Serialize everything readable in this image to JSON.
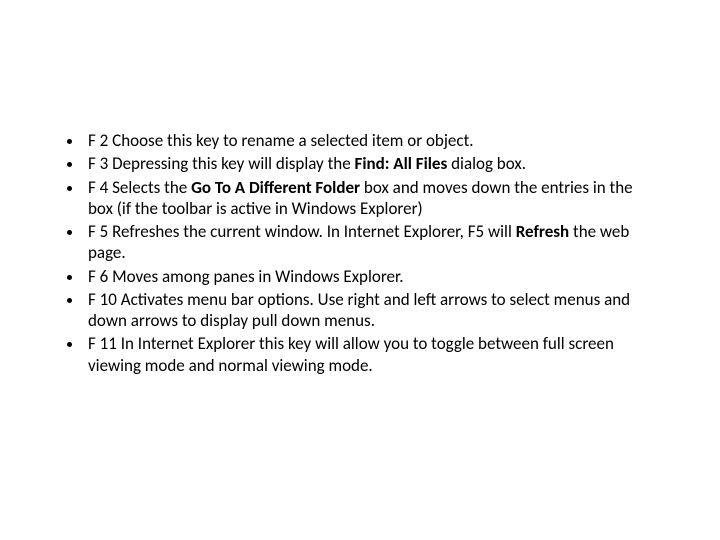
{
  "items": [
    {
      "key": "F 2",
      "pre": " Choose this key to rename a selected item or object."
    },
    {
      "key": "F 3",
      "pre": " Depressing this key will display the ",
      "bold1": "Find: All Files",
      "post1": " dialog box."
    },
    {
      "key": "F 4",
      "pre": " Selects the ",
      "bold1": "Go To A Different Folder",
      "post1": " box and moves down the entries in the box (if the toolbar is active in Windows Explorer)"
    },
    {
      "key": "F 5",
      "pre": " Refreshes the current window. In Internet Explorer, F5 will ",
      "bold1": "Refresh",
      "post1": " the web page."
    },
    {
      "key": "F 6",
      "pre": " Moves among panes in Windows Explorer."
    },
    {
      "key": "F 10",
      "pre": " Activates menu bar options. Use right and left arrows to select menus and down arrows to display pull down menus."
    },
    {
      "key": "F 11",
      "pre": " In Internet Explorer this key will allow you to toggle between full screen viewing mode and normal viewing mode."
    }
  ]
}
